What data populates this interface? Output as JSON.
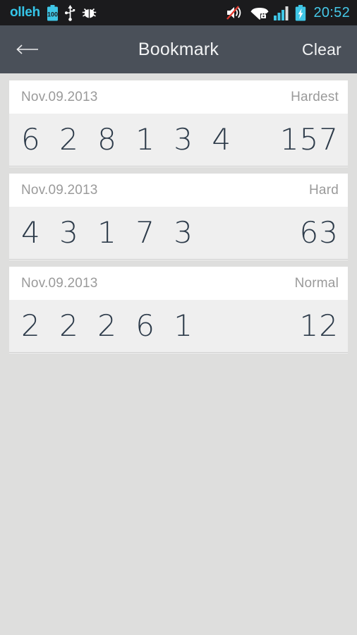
{
  "status_bar": {
    "carrier": "olleh",
    "time": "20:52",
    "battery_level_text": "100",
    "icons": [
      "battery-100-icon",
      "usb-icon",
      "bug-icon",
      "volume-muted-icon",
      "wifi-secure-icon",
      "signal-bars-icon",
      "battery-charging-icon"
    ],
    "carrier_color": "#35c5e8",
    "clock_color": "#46c8e8",
    "background": "#1b1b1d"
  },
  "app_bar": {
    "back_label": "←",
    "title": "Bookmark",
    "clear_label": "Clear",
    "background": "#4a5059",
    "text_color": "#f2f3f4"
  },
  "colors": {
    "page_background": "#dededd",
    "card_header_background": "#ffffff",
    "card_body_background": "#efefef",
    "meta_text": "#9a9a9a",
    "digit_text": "#2d3b4a"
  },
  "bookmarks": [
    {
      "date": "Nov.09.2013",
      "level": "Hardest",
      "digits": "6 2 8 1 3 4",
      "score": "157"
    },
    {
      "date": "Nov.09.2013",
      "level": "Hard",
      "digits": "4 3 1 7 3",
      "score": "63"
    },
    {
      "date": "Nov.09.2013",
      "level": "Normal",
      "digits": "2 2 2 6 1",
      "score": "12"
    }
  ]
}
